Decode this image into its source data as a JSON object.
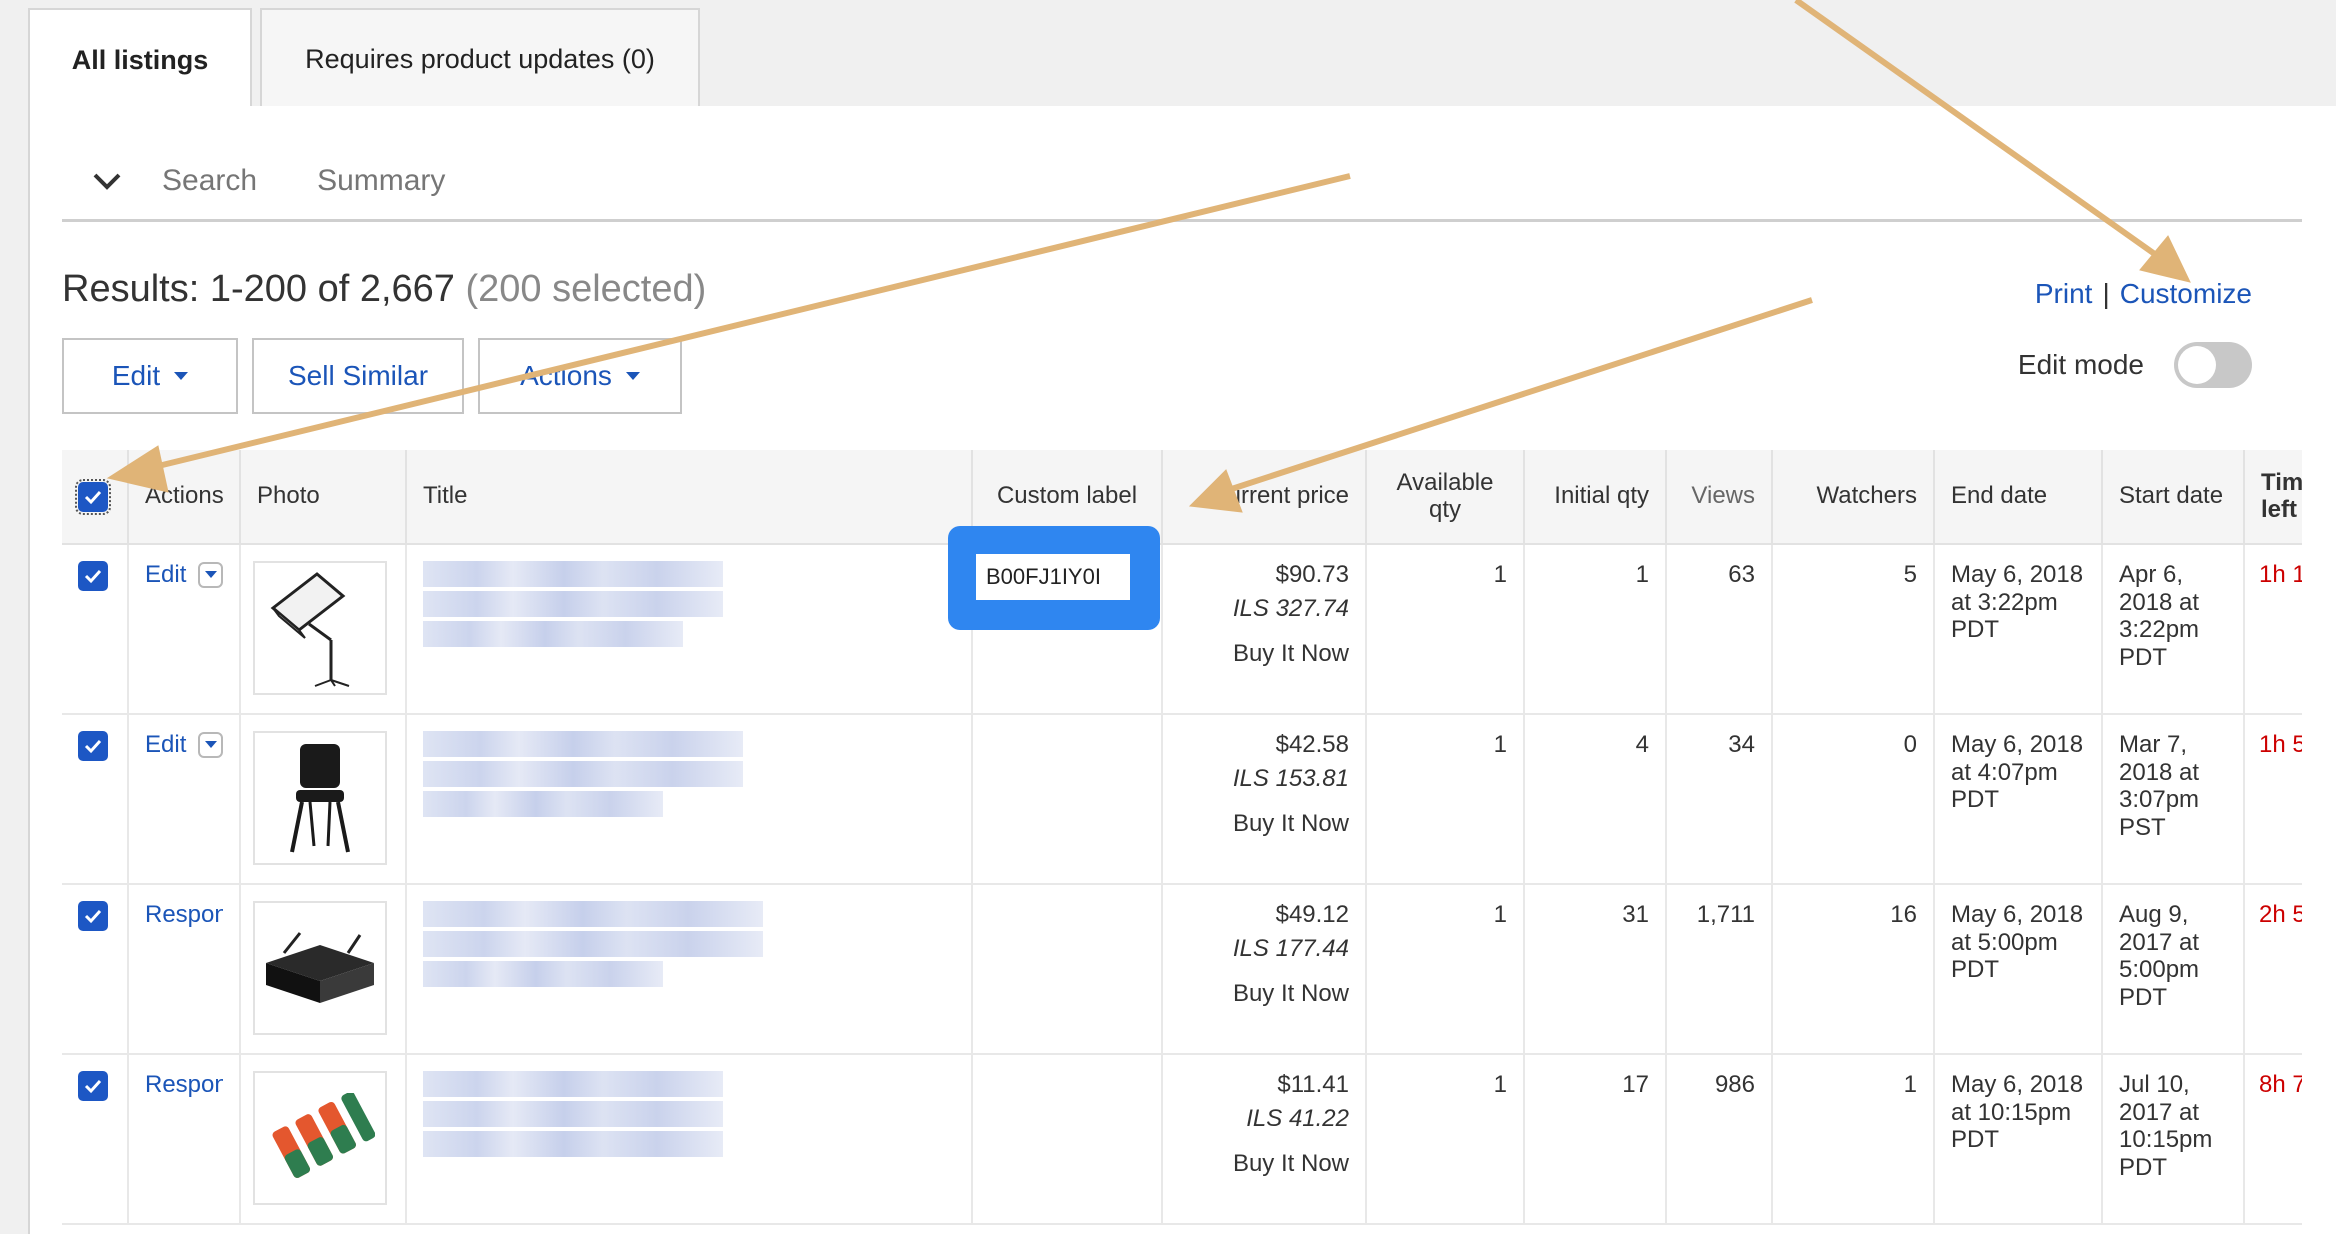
{
  "tabs": [
    {
      "label": "All listings",
      "active": true
    },
    {
      "label": "Requires product updates (0)",
      "active": false
    }
  ],
  "subnav": {
    "search": "Search",
    "summary": "Summary"
  },
  "results": {
    "text": "Results: 1-200 of 2,667",
    "selected": "(200 selected)"
  },
  "links": {
    "print": "Print",
    "separator": "|",
    "customize": "Customize"
  },
  "buttons": {
    "edit": "Edit",
    "sell_similar": "Sell Similar",
    "actions": "Actions"
  },
  "edit_mode": {
    "label": "Edit mode",
    "on": false
  },
  "table": {
    "headers": {
      "actions": "Actions",
      "photo": "Photo",
      "title": "Title",
      "custom_label": "Custom label",
      "current_price": "Current price",
      "available_qty": "Available qty",
      "initial_qty": "Initial qty",
      "views": "Views",
      "watchers": "Watchers",
      "end_date": "End date",
      "start_date": "Start date",
      "time_left": "Time left"
    },
    "rows": [
      {
        "action": "Edit",
        "custom_label": "B00FJ1IY0I",
        "price": "$90.73",
        "price_ils": "ILS 327.74",
        "format": "Buy It Now",
        "available": "1",
        "initial": "1",
        "views": "63",
        "watchers": "5",
        "end": "May 6, 2018 at 3:22pm PDT",
        "start": "Apr 6, 2018 at 3:22pm PDT",
        "time_left": "1h 1",
        "photo_icon": "softbox-light-icon"
      },
      {
        "action": "Edit",
        "custom_label": "",
        "price": "$42.58",
        "price_ils": "ILS 153.81",
        "format": "Buy It Now",
        "available": "1",
        "initial": "4",
        "views": "34",
        "watchers": "0",
        "end": "May 6, 2018 at 4:07pm PDT",
        "start": "Mar 7, 2018 at 3:07pm PST",
        "time_left": "1h 5",
        "photo_icon": "chair-icon"
      },
      {
        "action": "Respond",
        "custom_label": "",
        "price": "$49.12",
        "price_ils": "ILS 177.44",
        "format": "Buy It Now",
        "available": "1",
        "initial": "31",
        "views": "1,711",
        "watchers": "16",
        "end": "May 6, 2018 at 5:00pm PDT",
        "start": "Aug 9, 2017 at 5:00pm PDT",
        "time_left": "2h 5",
        "photo_icon": "equipment-case-icon"
      },
      {
        "action": "Respond",
        "custom_label": "",
        "price": "$11.41",
        "price_ils": "ILS 41.22",
        "format": "Buy It Now",
        "available": "1",
        "initial": "17",
        "views": "986",
        "watchers": "1",
        "end": "May 6, 2018 at 10:15pm PDT",
        "start": "Jul 10, 2017 at 10:15pm PDT",
        "time_left": "8h 7",
        "photo_icon": "cable-connectors-icon"
      }
    ]
  },
  "colors": {
    "link": "#1b55b8",
    "checkbox": "#1d57c4",
    "highlight": "#2f86f0",
    "arrow": "#e0b477",
    "time_left": "#cc0000"
  }
}
